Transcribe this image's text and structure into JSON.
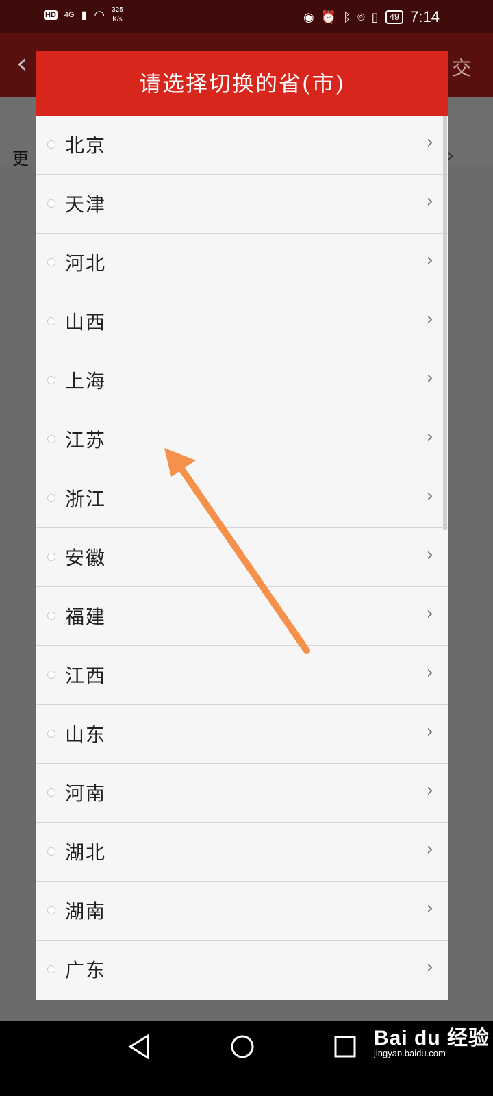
{
  "status_bar": {
    "hd": "HD",
    "network": "4G",
    "speed_value": "325",
    "speed_unit": "K/s",
    "battery": "49",
    "time": "7:14",
    "icons": [
      "signal-icon",
      "wifi-icon",
      "eye-icon",
      "alarm-icon",
      "bluetooth-icon",
      "location-icon",
      "vibrate-icon",
      "battery-icon"
    ]
  },
  "background": {
    "header_right_char": "交",
    "row_text": "更"
  },
  "dialog": {
    "title": "请选择切换的省(市)",
    "items": [
      {
        "label": "北京"
      },
      {
        "label": "天津"
      },
      {
        "label": "河北"
      },
      {
        "label": "山西"
      },
      {
        "label": "上海"
      },
      {
        "label": "江苏"
      },
      {
        "label": "浙江"
      },
      {
        "label": "安徽"
      },
      {
        "label": "福建"
      },
      {
        "label": "江西"
      },
      {
        "label": "山东"
      },
      {
        "label": "河南"
      },
      {
        "label": "湖北"
      },
      {
        "label": "湖南"
      },
      {
        "label": "广东"
      }
    ]
  },
  "annotation": {
    "color": "#f5914a"
  },
  "colors": {
    "dialog_header": "#d8261d",
    "status_bar": "#3f0a0a"
  },
  "watermark": {
    "brand": "Bai du 经验",
    "url": "jingyan.baidu.com"
  }
}
